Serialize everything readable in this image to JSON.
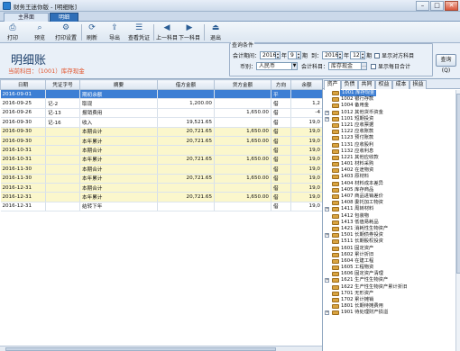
{
  "window": {
    "title": "财务王迷你版 - [明细账]",
    "btn_min": "–",
    "btn_max": "□",
    "btn_close": "✕"
  },
  "tabs": [
    "主界面",
    "明细账"
  ],
  "toolbar": [
    {
      "label": "打印",
      "icon": "printer-icon",
      "glyph": "⎙"
    },
    {
      "label": "预览",
      "icon": "preview-icon",
      "glyph": "⌕"
    },
    {
      "label": "打印设置",
      "icon": "print-settings-icon",
      "glyph": "⚙"
    },
    {
      "label": "刷新",
      "icon": "refresh-icon",
      "glyph": "⟳"
    },
    {
      "label": "导出",
      "icon": "export-icon",
      "glyph": "⇪"
    },
    {
      "label": "查看凭证",
      "icon": "view-voucher-icon",
      "glyph": "☰"
    },
    {
      "label": "上一科目",
      "icon": "prev-subject-icon",
      "glyph": "◀"
    },
    {
      "label": "下一科目",
      "icon": "next-subject-icon",
      "glyph": "▶"
    },
    {
      "label": "退出",
      "icon": "exit-icon",
      "glyph": "⏏"
    }
  ],
  "header": {
    "page_title": "明细账",
    "current_subject": "当前科目：（1001）库存现金"
  },
  "query": {
    "legend": "查询条件",
    "period_label": "会计期间：",
    "from_year": "2016",
    "year_unit": "年",
    "from_month": "9",
    "month_unit": "期",
    "to_label": "到：",
    "to_year": "2016",
    "to_month": "12",
    "opposite_label": "显示对方科目",
    "currency_label": "币别：",
    "currency_value": "人民币",
    "subject_label": "会计科目：",
    "subject_value": "库存现金",
    "daily_label": "显示每日合计",
    "query_button": "查询(Q)"
  },
  "grid": {
    "columns": [
      "日期",
      "凭证字号",
      "摘要",
      "借方金额",
      "贷方金额",
      "方向",
      "余额"
    ],
    "rows": [
      {
        "style": "sel",
        "cells": [
          "2016-09-01",
          "",
          "期初余额",
          "",
          "",
          "平",
          ""
        ]
      },
      {
        "style": "plain",
        "cells": [
          "2016-09-25",
          "记-2",
          "取现",
          "1,200.00",
          "",
          "借",
          "1,2"
        ]
      },
      {
        "style": "plain",
        "cells": [
          "2016-09-26",
          "记-13",
          "报销费用",
          "",
          "1,650.00",
          "借",
          "-4"
        ]
      },
      {
        "style": "plain",
        "cells": [
          "2016-09-30",
          "记-16",
          "收入",
          "19,521.65",
          "",
          "借",
          "19,0"
        ]
      },
      {
        "style": "sum",
        "cells": [
          "2016-09-30",
          "",
          "本期合计",
          "20,721.65",
          "1,650.00",
          "借",
          "19,0"
        ]
      },
      {
        "style": "sum",
        "cells": [
          "2016-09-30",
          "",
          "本年累计",
          "20,721.65",
          "1,650.00",
          "借",
          "19,0"
        ]
      },
      {
        "style": "sum",
        "cells": [
          "2016-10-31",
          "",
          "本期合计",
          "",
          "",
          "借",
          "19,0"
        ]
      },
      {
        "style": "sum",
        "cells": [
          "2016-10-31",
          "",
          "本年累计",
          "20,721.65",
          "1,650.00",
          "借",
          "19,0"
        ]
      },
      {
        "style": "sum",
        "cells": [
          "2016-11-30",
          "",
          "本期合计",
          "",
          "",
          "借",
          "19,0"
        ]
      },
      {
        "style": "sum",
        "cells": [
          "2016-11-30",
          "",
          "本年累计",
          "20,721.65",
          "1,650.00",
          "借",
          "19,0"
        ]
      },
      {
        "style": "sum",
        "cells": [
          "2016-12-31",
          "",
          "本期合计",
          "",
          "",
          "借",
          "19,0"
        ]
      },
      {
        "style": "sum",
        "cells": [
          "2016-12-31",
          "",
          "本年累计",
          "20,721.65",
          "1,650.00",
          "借",
          "19,0"
        ]
      },
      {
        "style": "plain",
        "cells": [
          "2016-12-31",
          "",
          "结转下年",
          "",
          "",
          "借",
          "19,0"
        ]
      }
    ]
  },
  "category_tabs": [
    "资产",
    "负债",
    "共同",
    "权益",
    "成本",
    "损益"
  ],
  "tree": [
    {
      "text": "1001 库存现金",
      "exp": "",
      "sel": true
    },
    {
      "text": "1002 银行存款",
      "exp": ""
    },
    {
      "text": "1004 备用金",
      "exp": ""
    },
    {
      "text": "1012 其他货币资金",
      "exp": "+"
    },
    {
      "text": "1101 短期投资",
      "exp": "+"
    },
    {
      "text": "1121 应收票据",
      "exp": ""
    },
    {
      "text": "1122 应收账款",
      "exp": ""
    },
    {
      "text": "1123 预付账款",
      "exp": ""
    },
    {
      "text": "1131 应收股利",
      "exp": ""
    },
    {
      "text": "1132 应收利息",
      "exp": ""
    },
    {
      "text": "1221 其他应收款",
      "exp": ""
    },
    {
      "text": "1401 材料采购",
      "exp": ""
    },
    {
      "text": "1402 在途物资",
      "exp": ""
    },
    {
      "text": "1403 原材料",
      "exp": ""
    },
    {
      "text": "1404 材料成本差异",
      "exp": ""
    },
    {
      "text": "1405 库存商品",
      "exp": ""
    },
    {
      "text": "1407 商品进销差价",
      "exp": ""
    },
    {
      "text": "1408 委托加工物资",
      "exp": ""
    },
    {
      "text": "1411 周转材料",
      "exp": "+"
    },
    {
      "text": "1412 包装物",
      "exp": ""
    },
    {
      "text": "1413 低值易耗品",
      "exp": ""
    },
    {
      "text": "1421 消耗性生物资产",
      "exp": ""
    },
    {
      "text": "1501 长期债券投资",
      "exp": "+"
    },
    {
      "text": "1511 长期股权投资",
      "exp": ""
    },
    {
      "text": "1601 固定资产",
      "exp": ""
    },
    {
      "text": "1602 累计折旧",
      "exp": ""
    },
    {
      "text": "1604 在建工程",
      "exp": ""
    },
    {
      "text": "1605 工程物资",
      "exp": ""
    },
    {
      "text": "1606 固定资产清理",
      "exp": ""
    },
    {
      "text": "1621 生产性生物资产",
      "exp": "+"
    },
    {
      "text": "1622 生产性生物资产累计折旧",
      "exp": ""
    },
    {
      "text": "1701 无形资产",
      "exp": ""
    },
    {
      "text": "1702 累计摊销",
      "exp": ""
    },
    {
      "text": "1801 长期待摊费用",
      "exp": ""
    },
    {
      "text": "1901 待处理财产损溢",
      "exp": "+"
    }
  ]
}
